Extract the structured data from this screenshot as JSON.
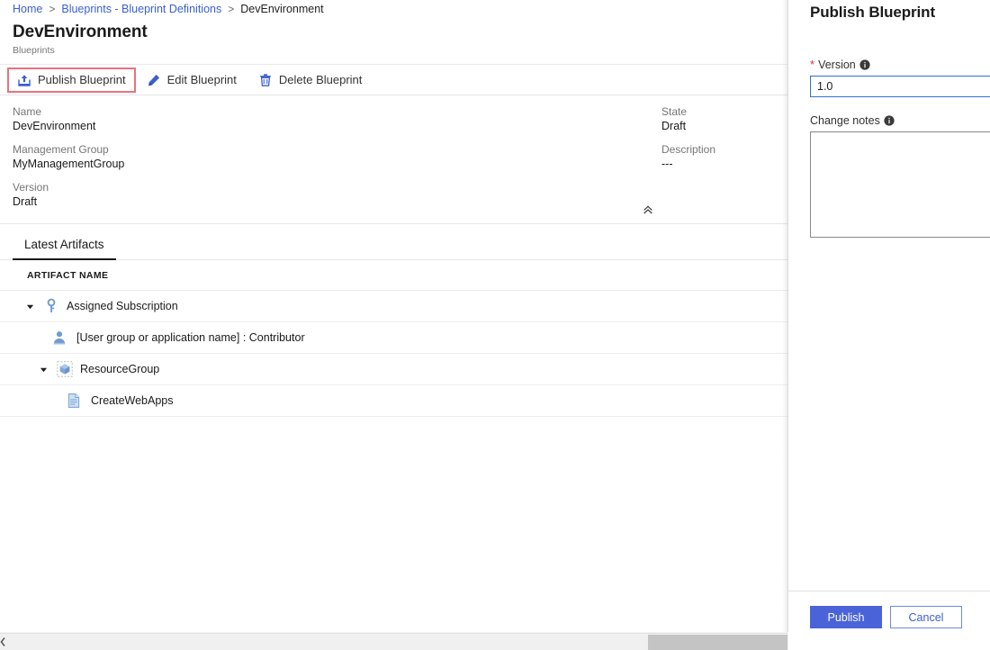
{
  "breadcrumb": {
    "items": [
      {
        "label": "Home",
        "link": true
      },
      {
        "label": "Blueprints - Blueprint Definitions",
        "link": true
      },
      {
        "label": "DevEnvironment",
        "link": false
      }
    ],
    "separator": ">"
  },
  "blade": {
    "title": "DevEnvironment",
    "subtitle": "Blueprints"
  },
  "commandbar": {
    "publish": {
      "label": "Publish Blueprint",
      "icon": "publish-icon",
      "highlighted": true
    },
    "edit": {
      "label": "Edit Blueprint",
      "icon": "pencil-icon"
    },
    "delete": {
      "label": "Delete Blueprint",
      "icon": "trash-icon"
    }
  },
  "essentials": {
    "left": [
      {
        "label": "Name",
        "value": "DevEnvironment"
      },
      {
        "label": "Management Group",
        "value": "MyManagementGroup"
      },
      {
        "label": "Version",
        "value": "Draft"
      }
    ],
    "right": [
      {
        "label": "State",
        "value": "Draft"
      },
      {
        "label": "Description",
        "value": "---"
      }
    ],
    "collapse_icon": "double-chevron-up-icon"
  },
  "tabs": [
    {
      "label": "Latest Artifacts",
      "active": true
    }
  ],
  "artifacts": {
    "column_header": "ARTIFACT NAME",
    "rows": [
      {
        "label": "Assigned Subscription",
        "icon": "key-icon",
        "indent": "ind-0",
        "expandable": true,
        "expanded": true
      },
      {
        "label": "[User group or application name] : Contributor",
        "icon": "user-icon",
        "indent": "ind-1",
        "expandable": false
      },
      {
        "label": "ResourceGroup",
        "icon": "resource-group-icon",
        "indent": "ind-1b",
        "expandable": true,
        "expanded": true
      },
      {
        "label": "CreateWebApps",
        "icon": "template-document-icon",
        "indent": "ind-2",
        "expandable": false
      }
    ]
  },
  "pane": {
    "title": "Publish Blueprint",
    "version_field": {
      "label": "Version",
      "required_marker": "*",
      "info_icon": "info-icon",
      "value": "1.0",
      "placeholder": ""
    },
    "change_notes_field": {
      "label": "Change notes",
      "info_icon": "info-icon",
      "value": "",
      "placeholder": ""
    },
    "publish_button": "Publish",
    "cancel_button": "Cancel"
  },
  "colors": {
    "accent_blue": "#3b5fd1",
    "primary_button": "#4a63d8",
    "highlight_red": "#e8737f",
    "required_red": "#d13438",
    "icon_blue": "#5b82c6",
    "command_icon_blue": "#3b5fd1"
  }
}
